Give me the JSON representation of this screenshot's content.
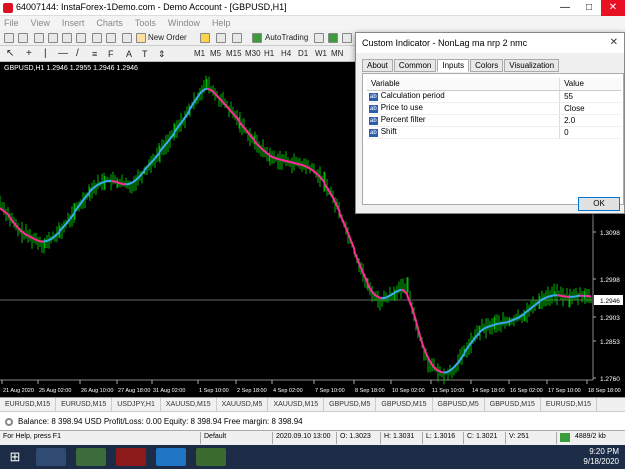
{
  "window": {
    "title": "64007144: InstaForex-1Demo.com - Demo Account - [GBPUSD,H1]",
    "minimize": "—",
    "maximize": "□",
    "close": "✕"
  },
  "menu": [
    "File",
    "View",
    "Insert",
    "Charts",
    "Tools",
    "Window",
    "Help"
  ],
  "toolbar": {
    "new_order": "New Order",
    "autotrading": "AutoTrading",
    "timeframes": [
      "M1",
      "M5",
      "M15",
      "M30",
      "H1",
      "H4",
      "D1",
      "W1",
      "MN"
    ]
  },
  "chart": {
    "label": "GBPUSD,H1  1.2946  1.2955  1.2946  1.2946",
    "current_price": "1.2946",
    "price_ticks": [
      "1.3098",
      "1.2998",
      "1.2903",
      "1.2853",
      "1.2760"
    ],
    "date_ticks": [
      "21 Aug 2020",
      "25 Aug 02:00",
      "26 Aug 10:00",
      "27 Aug 18:00",
      "31 Aug 02:00",
      "1 Sep 10:00",
      "2 Sep 18:00",
      "4 Sep 02:00",
      "7 Sep 10:00",
      "8 Sep 18:00",
      "10 Sep 02:00",
      "11 Sep 10:00",
      "14 Sep 18:00",
      "16 Sep 02:00",
      "17 Sep 10:00",
      "18 Sep 18:00"
    ],
    "colors": {
      "candles": "#00cc00",
      "nonlag_up": "#3aaaf0",
      "nonlag_down": "#ff2a9a",
      "background": "#000000",
      "price_line": "#cccccc"
    }
  },
  "dialog": {
    "title": "Custom Indicator - NonLag ma nrp 2 nmc",
    "close": "✕",
    "tabs": [
      "About",
      "Common",
      "Inputs",
      "Colors",
      "Visualization"
    ],
    "active_tab": "Inputs",
    "columns": [
      "Variable",
      "Value"
    ],
    "rows": [
      {
        "badge": "ab",
        "variable": "Calculation period",
        "value": "55"
      },
      {
        "badge": "ab",
        "variable": "Price to use",
        "value": "Close"
      },
      {
        "badge": "ab",
        "variable": "Percent filter",
        "value": "2.0"
      },
      {
        "badge": "ab",
        "variable": "Shift",
        "value": "0"
      }
    ],
    "ok": "OK"
  },
  "symbol_tabs": [
    "EURUSD,M15",
    "EURUSD,M15",
    "USDJPY,H1",
    "XAUUSD,M15",
    "XAUUSD,M5",
    "XAUUSD,M15",
    "GBPUSD,M5",
    "GBPUSD,M15",
    "GBPUSD,M5",
    "GBPUSD,M15",
    "EURUSD,M15"
  ],
  "balance": "Balance: 8 398.94 USD  Profit/Loss: 0.00  Equity: 8 398.94  Free margin: 8 398.94",
  "status": {
    "help": "For Help, press F1",
    "profile": "Default",
    "datetime": "2020.09.10 13:00",
    "open": "O: 1.3023",
    "high": "H: 1.3031",
    "low": "L: 1.3016",
    "close": "C: 1.3021",
    "volume": "V: 251",
    "traffic": "4889/2 kb"
  },
  "taskbar": {
    "time": "9:20 PM",
    "date": "9/18/2020"
  }
}
